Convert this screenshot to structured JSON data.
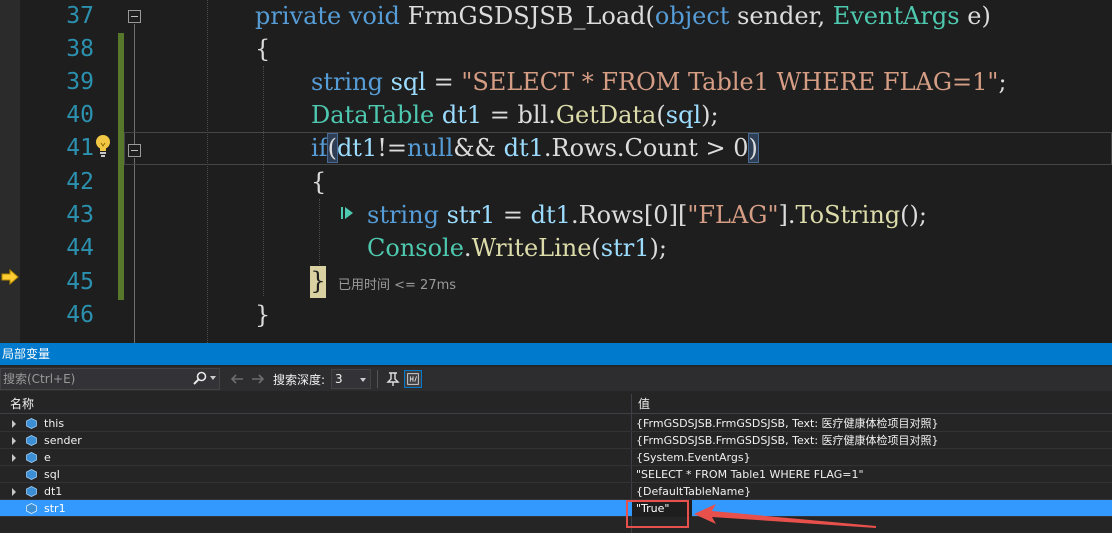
{
  "editor": {
    "lines": [
      {
        "num": "37"
      },
      {
        "num": "38"
      },
      {
        "num": "39"
      },
      {
        "num": "40"
      },
      {
        "num": "41"
      },
      {
        "num": "42"
      },
      {
        "num": "43"
      },
      {
        "num": "44"
      },
      {
        "num": "45"
      },
      {
        "num": "46"
      }
    ],
    "code": {
      "l37_kw1": "private",
      "l37_kw2": "void",
      "l37_name": "FrmGSDSJSB_Load",
      "l37_open": "(",
      "l37_kw3": "object",
      "l37_p1": "sender",
      "l37_comma": ", ",
      "l37_ty": "EventArgs",
      "l37_p2": "e",
      "l37_close": ")",
      "l38": "{",
      "l39_kw": "string",
      "l39_id": "sql",
      "l39_eq": " = ",
      "l39_str": "\"SELECT * FROM Table1 WHERE FLAG=1\"",
      "l39_end": ";",
      "l40_ty": "DataTable",
      "l40_id": "dt1",
      "l40_eq": " = bll.",
      "l40_me": "GetData",
      "l40_open": "(",
      "l40_arg": "sql",
      "l40_end": ");",
      "l41_kw": "if",
      "l41_open": "(",
      "l41_a": "dt1",
      "l41_ne": "!=",
      "l41_null": "null",
      "l41_and": "&& ",
      "l41_b": "dt1",
      "l41_dot": ".Rows.Count > 0",
      "l41_close": ")",
      "l42": "{",
      "l43_kw": "string",
      "l43_id": "str1",
      "l43_eq": " = ",
      "l43_b": "dt1",
      "l43_rows": ".Rows[0][",
      "l43_str": "\"FLAG\"",
      "l43_rb": "].",
      "l43_me": "ToString",
      "l43_end": "();",
      "l44_ty": "Console",
      "l44_dot": ".",
      "l44_me": "WriteLine",
      "l44_open": "(",
      "l44_arg": "str1",
      "l44_end": ");",
      "l45": "}",
      "l46": "}"
    },
    "elapsed": "已用时间 <= 27ms"
  },
  "locals": {
    "title": "局部变量",
    "search_placeholder": "搜索(Ctrl+E)",
    "depth_label": "搜索深度:",
    "depth_value": "3",
    "col_name": "名称",
    "col_value": "值",
    "rows": [
      {
        "name": "this",
        "value": "{FrmGSDSJSB.FrmGSDSJSB, Text: 医疗健康体检项目对照}",
        "expandable": true
      },
      {
        "name": "sender",
        "value": "{FrmGSDSJSB.FrmGSDSJSB, Text: 医疗健康体检项目对照}",
        "expandable": true
      },
      {
        "name": "e",
        "value": "{System.EventArgs}",
        "expandable": true
      },
      {
        "name": "sql",
        "value": "\"SELECT * FROM Table1 WHERE FLAG=1\"",
        "expandable": false
      },
      {
        "name": "dt1",
        "value": "{DefaultTableName}",
        "expandable": true
      },
      {
        "name": "str1",
        "value": "\"True\"",
        "expandable": false,
        "selected": true
      }
    ]
  },
  "colors": {
    "accent": "#007acc",
    "selection": "#3399ff",
    "annotation": "#e8504b"
  }
}
